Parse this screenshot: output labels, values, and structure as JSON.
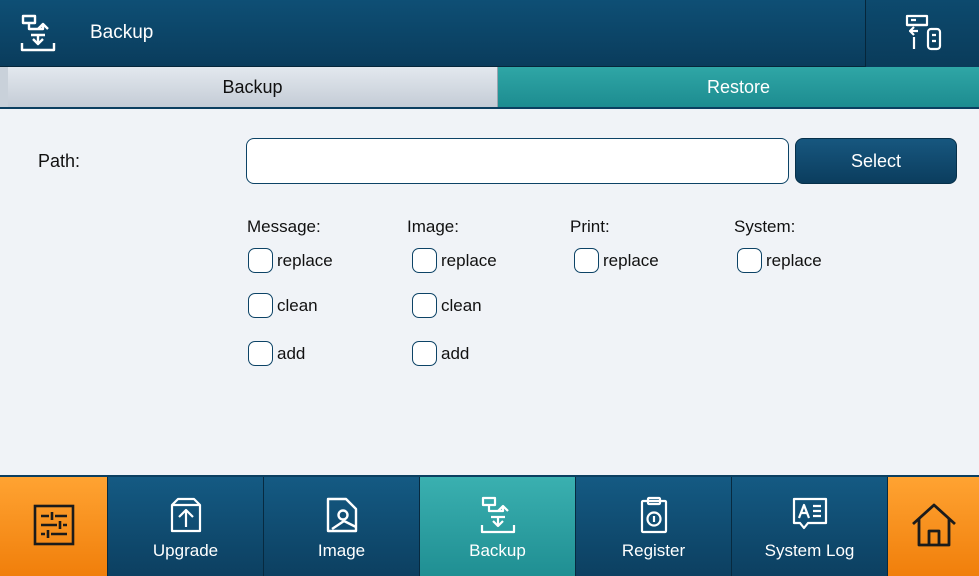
{
  "header": {
    "title": "Backup",
    "icon": "backup-icon",
    "right_icon": "usb-transfer-icon"
  },
  "tabs": [
    {
      "label": "Backup",
      "active": true
    },
    {
      "label": "Restore",
      "active": false
    }
  ],
  "path": {
    "label": "Path:",
    "value": "",
    "placeholder": "",
    "button_label": "Select"
  },
  "groups": [
    {
      "title": "Message:",
      "options": [
        "replace",
        "clean",
        "add"
      ]
    },
    {
      "title": "Image:",
      "options": [
        "replace",
        "clean",
        "add"
      ]
    },
    {
      "title": "Print:",
      "options": [
        "replace"
      ]
    },
    {
      "title": "System:",
      "options": [
        "replace"
      ]
    }
  ],
  "nav": [
    {
      "label": "",
      "icon": "settings-sliders-icon",
      "style": "orange"
    },
    {
      "label": "Upgrade",
      "icon": "upgrade-icon",
      "style": "blue"
    },
    {
      "label": "Image",
      "icon": "image-tag-icon",
      "style": "blue"
    },
    {
      "label": "Backup",
      "icon": "backup-icon",
      "style": "active"
    },
    {
      "label": "Register",
      "icon": "register-icon",
      "style": "blue"
    },
    {
      "label": "System Log",
      "icon": "system-log-icon",
      "style": "blue"
    },
    {
      "label": "",
      "icon": "home-icon",
      "style": "orange"
    }
  ],
  "colors": {
    "header": "#0e4f75",
    "active_tab": "#2fa6a6",
    "orange": "#f7931e",
    "background": "#f0f3f7"
  }
}
